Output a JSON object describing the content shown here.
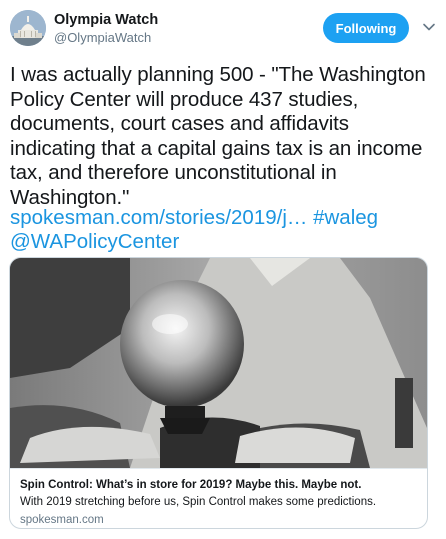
{
  "account": {
    "display_name": "Olympia Watch",
    "handle": "@OlympiaWatch",
    "follow_label": "Following"
  },
  "tweet": {
    "text": "I was actually planning 500 - \"The Washington Policy Center will produce 437 studies, documents, court cases and affidavits indicating that a capital gains tax is an income tax, and therefore unconstitutional in Washington.\"",
    "link": "spokesman.com/stories/2019/j…",
    "hashtag": "#waleg",
    "mention": "@WAPolicyCenter"
  },
  "card": {
    "title": "Spin Control: What’s in store for 2019? Maybe this. Maybe not.",
    "description": "With 2019 stretching before us, Spin Control makes some predictions.",
    "domain": "spokesman.com"
  },
  "colors": {
    "accent": "#1da1f2",
    "link": "#1b95e0",
    "secondary_text": "#657786"
  },
  "icons": {
    "caret": "chevron-down-icon",
    "avatar": "capitol-dome-avatar"
  }
}
